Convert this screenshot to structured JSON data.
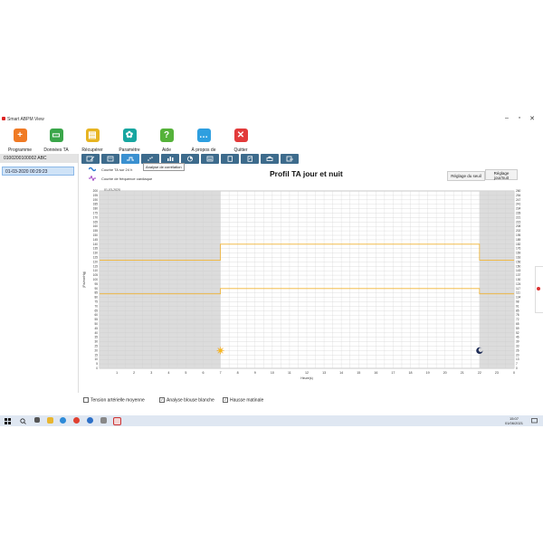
{
  "window": {
    "title": "Smart ABPM View",
    "controls": [
      "–",
      "▫",
      "✕"
    ]
  },
  "toolbar": [
    {
      "label": "Programme",
      "icon": "person-add-icon",
      "glyph": "+",
      "color": "#f07a24"
    },
    {
      "label": "Données TA",
      "icon": "data-folder-icon",
      "glyph": "▭",
      "color": "#3aa64a"
    },
    {
      "label": "Récupérer",
      "icon": "retrieve-icon",
      "glyph": "▤",
      "color": "#e7b421"
    },
    {
      "label": "Paramètre",
      "icon": "gear-icon",
      "glyph": "✿",
      "color": "#17a6a0"
    },
    {
      "label": "Aide",
      "icon": "help-icon",
      "glyph": "?",
      "color": "#55b23a"
    },
    {
      "label": "À propos de",
      "icon": "about-chat-icon",
      "glyph": "…",
      "color": "#2e9fe0"
    },
    {
      "label": "Quitter",
      "icon": "close-icon",
      "glyph": "✕",
      "color": "#e23a3a"
    }
  ],
  "sidebar": {
    "patient": "0100200100002 ABC",
    "session": "01-03-2020 00:29:23"
  },
  "tooltip": "Analyse de corrélation",
  "legend": {
    "bp_curve": "Courbe TA sur 24 h",
    "hr_curve": "Courbe de fréquence cardiaque"
  },
  "buttons": {
    "threshold": "Réglage du seuil",
    "daynight_line1": "Réglage",
    "daynight_line2": "jour/nuit"
  },
  "checkboxes": [
    {
      "label": "Tension artérielle moyenne",
      "checked": false
    },
    {
      "label": "Analyse blouse blanche",
      "checked": true
    },
    {
      "label": "Hausse matinale",
      "checked": true
    }
  ],
  "taskbar": {
    "time": "15:07",
    "date": "01/06/2021"
  },
  "chart_data": {
    "type": "line",
    "title": "Profil TA jour et nuit",
    "date_label": "01-03-2020",
    "xlabel": "Heure(s)",
    "ylabel": "(Pa/mmHg)",
    "x_ticks": [
      "1",
      "2",
      "3",
      "4",
      "5",
      "6",
      "7",
      "8",
      "9",
      "10",
      "11",
      "12",
      "13",
      "14",
      "15",
      "16",
      "17",
      "18",
      "19",
      "20",
      "21",
      "22",
      "23",
      "0"
    ],
    "ylim_left": [
      0,
      200
    ],
    "ylim_right": [
      0,
      260
    ],
    "y_step": 5,
    "night_shading": [
      [
        0,
        7
      ],
      [
        22,
        24
      ]
    ],
    "series": [
      {
        "values": [
          {
            "x": 0,
            "y": 122
          },
          {
            "x": 7,
            "y": 122
          },
          {
            "x": 7,
            "y": 140
          },
          {
            "x": 22,
            "y": 140
          },
          {
            "x": 22,
            "y": 122
          },
          {
            "x": 24,
            "y": 122
          }
        ],
        "color": "#f0b232"
      },
      {
        "values": [
          {
            "x": 0,
            "y": 84
          },
          {
            "x": 7,
            "y": 84
          },
          {
            "x": 7,
            "y": 90
          },
          {
            "x": 22,
            "y": 90
          },
          {
            "x": 22,
            "y": 84
          },
          {
            "x": 24,
            "y": 84
          }
        ],
        "color": "#f0b232"
      }
    ],
    "markers": [
      {
        "x": 7,
        "y": 20,
        "icon": "sun-icon"
      },
      {
        "x": 22,
        "y": 20,
        "icon": "moon-icon"
      }
    ],
    "grid": true
  }
}
